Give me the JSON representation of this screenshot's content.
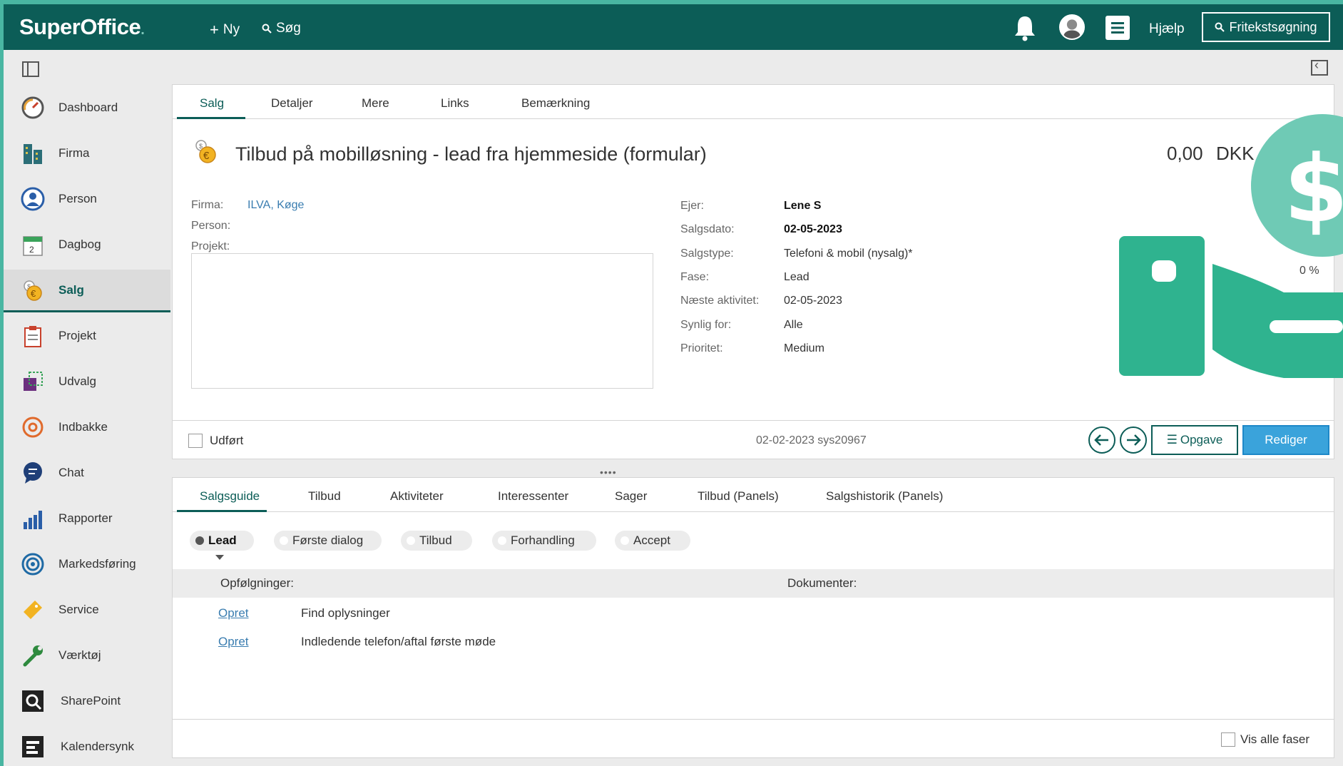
{
  "app": {
    "logo": "SuperOffice",
    "new_label": "Ny",
    "search_label": "Søg",
    "help_label": "Hjælp",
    "freetext_label": "Fritekstsøgning"
  },
  "sidebar": {
    "items": [
      {
        "label": "Dashboard",
        "icon": "gauge-icon"
      },
      {
        "label": "Firma",
        "icon": "building-icon"
      },
      {
        "label": "Person",
        "icon": "person-icon"
      },
      {
        "label": "Dagbog",
        "icon": "calendar-icon"
      },
      {
        "label": "Salg",
        "icon": "coins-icon",
        "active": true
      },
      {
        "label": "Projekt",
        "icon": "clipboard-icon"
      },
      {
        "label": "Udvalg",
        "icon": "selection-icon"
      },
      {
        "label": "Indbakke",
        "icon": "at-icon"
      },
      {
        "label": "Chat",
        "icon": "chat-icon"
      },
      {
        "label": "Rapporter",
        "icon": "bar-chart-icon"
      },
      {
        "label": "Markedsføring",
        "icon": "target-icon"
      },
      {
        "label": "Service",
        "icon": "ticket-icon"
      },
      {
        "label": "Værktøj",
        "icon": "wrench-icon"
      },
      {
        "label": "SharePoint",
        "icon": "sharepoint-icon"
      },
      {
        "label": "Kalendersynk",
        "icon": "sync-icon"
      }
    ]
  },
  "main": {
    "tabs": [
      "Salg",
      "Detaljer",
      "Mere",
      "Links",
      "Bemærkning"
    ],
    "title": "Tilbud på mobilløsning - lead fra hjemmeside (formular)",
    "amount": "0,00",
    "currency": "DKK",
    "left_fields": {
      "firma_label": "Firma:",
      "firma_value": "ILVA, Køge",
      "person_label": "Person:",
      "projekt_label": "Projekt:"
    },
    "right_fields": [
      {
        "label": "Ejer:",
        "value": "Lene S",
        "bold": true
      },
      {
        "label": "Salgsdato:",
        "value": "02-05-2023",
        "bold": true
      },
      {
        "label": "Salgstype:",
        "value": "Telefoni & mobil (nysalg)*"
      },
      {
        "label": "Fase:",
        "value": "Lead"
      },
      {
        "label": "Næste aktivitet:",
        "value": "02-05-2023"
      },
      {
        "label": "Synlig for:",
        "value": "Alle"
      },
      {
        "label": "Prioritet:",
        "value": "Medium"
      }
    ],
    "probability": "0 %",
    "done_label": "Udført",
    "created_info": "02-02-2023 sys20967",
    "task_button": "Opgave",
    "edit_button": "Rediger"
  },
  "bottom": {
    "tabs": [
      "Salgsguide",
      "Tilbud",
      "Aktiviteter",
      "Interessenter",
      "Sager",
      "Tilbud (Panels)",
      "Salgshistorik (Panels)"
    ],
    "stages": [
      "Lead",
      "Første dialog",
      "Tilbud",
      "Forhandling",
      "Accept"
    ],
    "followups_label": "Opfølgninger:",
    "documents_label": "Dokumenter:",
    "tasks": [
      {
        "link": "Opret",
        "text": "Find oplysninger"
      },
      {
        "link": "Opret",
        "text": "Indledende telefon/aftal første møde"
      }
    ],
    "show_all_label": "Vis alle faser"
  },
  "colors": {
    "header": "#0c5d57",
    "accent_blue": "#3aa3db",
    "deco_green": "#2fb38f",
    "deco_light": "#6fcab5",
    "background": "#49b6a2"
  }
}
